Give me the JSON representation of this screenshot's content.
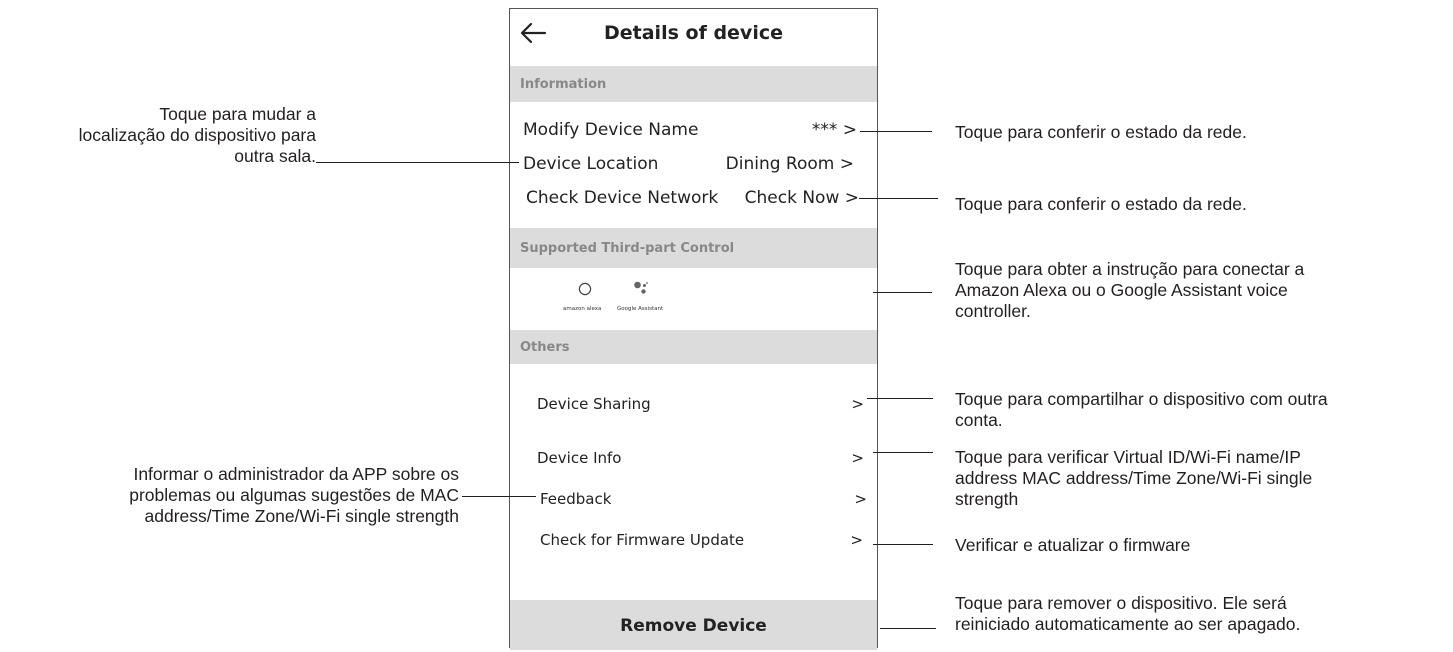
{
  "app": {
    "title": "Details of device",
    "back_icon": "back-arrow-icon"
  },
  "sections": {
    "information": "Information",
    "third_party": "Supported Third-part Control",
    "others": "Others"
  },
  "info_rows": [
    {
      "label": "Modify Device Name",
      "value": "*** >"
    },
    {
      "label": "Device Location",
      "value": "Dining Room >"
    },
    {
      "label": "Check Device Network",
      "value": "Check Now >"
    }
  ],
  "third_party": {
    "alexa_label": "amazon alexa",
    "google_label": "Google Assistant"
  },
  "other_rows": [
    {
      "label": "Device Sharing",
      "chevron": ">"
    },
    {
      "label": "Device Info",
      "chevron": ">"
    },
    {
      "label": "Feedback",
      "chevron": ">"
    },
    {
      "label": "Check for Firmware Update",
      "chevron": ">"
    }
  ],
  "remove_label": "Remove Device",
  "annotations": {
    "left_location": [
      "Toque para mudar a",
      "localização do dispositivo para",
      "outra sala."
    ],
    "left_feedback": [
      "Informar o administrador da APP sobre os",
      "problemas ou algumas sugestões de MAC",
      "address/Time Zone/Wi-Fi single strength"
    ],
    "right_name": "Toque para conferir o estado da rede.",
    "right_network": "Toque para conferir o estado da rede.",
    "right_third": [
      "Toque para obter a instrução para conectar a",
      "Amazon Alexa ou o Google Assistant voice",
      "controller."
    ],
    "right_sharing": [
      "Toque para compartilhar o dispositivo com outra",
      "conta."
    ],
    "right_info": [
      "Toque para verificar Virtual ID/Wi-Fi name/IP",
      "address MAC address/Time Zone/Wi-Fi single",
      "strength"
    ],
    "right_firmware": "Verificar e atualizar o firmware",
    "right_remove": [
      "Toque para remover o dispositivo. Ele será",
      "reiniciado automaticamente ao ser apagado."
    ]
  }
}
